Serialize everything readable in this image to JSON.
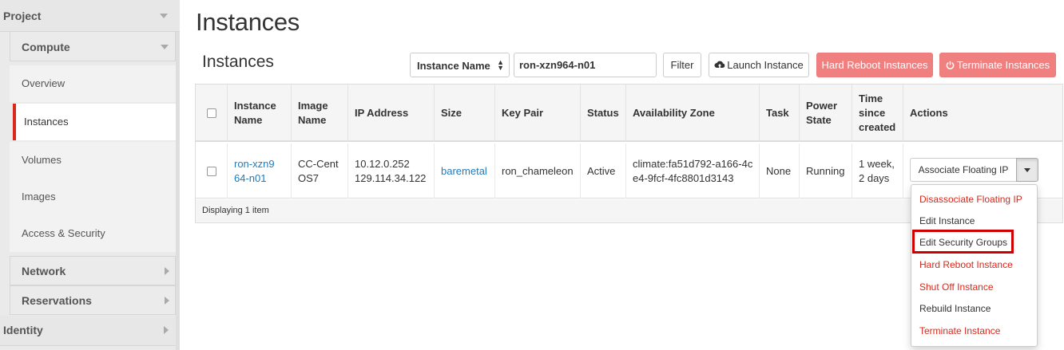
{
  "sidebar": {
    "project_label": "Project",
    "compute_label": "Compute",
    "items": [
      {
        "label": "Overview"
      },
      {
        "label": "Instances"
      },
      {
        "label": "Volumes"
      },
      {
        "label": "Images"
      },
      {
        "label": "Access & Security"
      }
    ],
    "network_label": "Network",
    "reservations_label": "Reservations",
    "identity_label": "Identity"
  },
  "header": {
    "page_title": "Instances",
    "section_title": "Instances"
  },
  "toolbar": {
    "filter_field": "Instance Name",
    "search_value": "ron-xzn964-n01",
    "filter_button": "Filter",
    "launch_button": "Launch Instance",
    "hard_reboot_button": "Hard Reboot Instances",
    "terminate_button": "Terminate Instances"
  },
  "table": {
    "columns": [
      "Instance Name",
      "Image Name",
      "IP Address",
      "Size",
      "Key Pair",
      "Status",
      "Availability Zone",
      "Task",
      "Power State",
      "Time since created",
      "Actions"
    ],
    "rows": [
      {
        "instance_name": "ron-xzn964-n01",
        "image_name": "CC-CentOS7",
        "ip_address_1": "10.12.0.252",
        "ip_address_2": "129.114.34.122",
        "size": "baremetal",
        "key_pair": "ron_chameleon",
        "status": "Active",
        "availability_zone": "climate:fa51d792-a166-4ce4-9fcf-4fc8801d3143",
        "task": "None",
        "power_state": "Running",
        "time_since_created": "1 week, 2 days",
        "action_label": "Associate Floating IP"
      }
    ],
    "footer": "Displaying 1 item"
  },
  "action_menu": {
    "items": [
      {
        "label": "Disassociate Floating IP",
        "style": "danger"
      },
      {
        "label": "Edit Instance",
        "style": "normal"
      },
      {
        "label": "Edit Security Groups",
        "style": "normal"
      },
      {
        "label": "Hard Reboot Instance",
        "style": "danger"
      },
      {
        "label": "Shut Off Instance",
        "style": "danger"
      },
      {
        "label": "Rebuild Instance",
        "style": "normal"
      },
      {
        "label": "Terminate Instance",
        "style": "danger"
      }
    ]
  },
  "colors": {
    "danger": "#d9291c",
    "link": "#1f7bbb",
    "danger_button": "#f08080",
    "highlight": "#d00000"
  },
  "icons": {
    "launch": "cloud-upload-icon",
    "terminate": "power-icon"
  }
}
